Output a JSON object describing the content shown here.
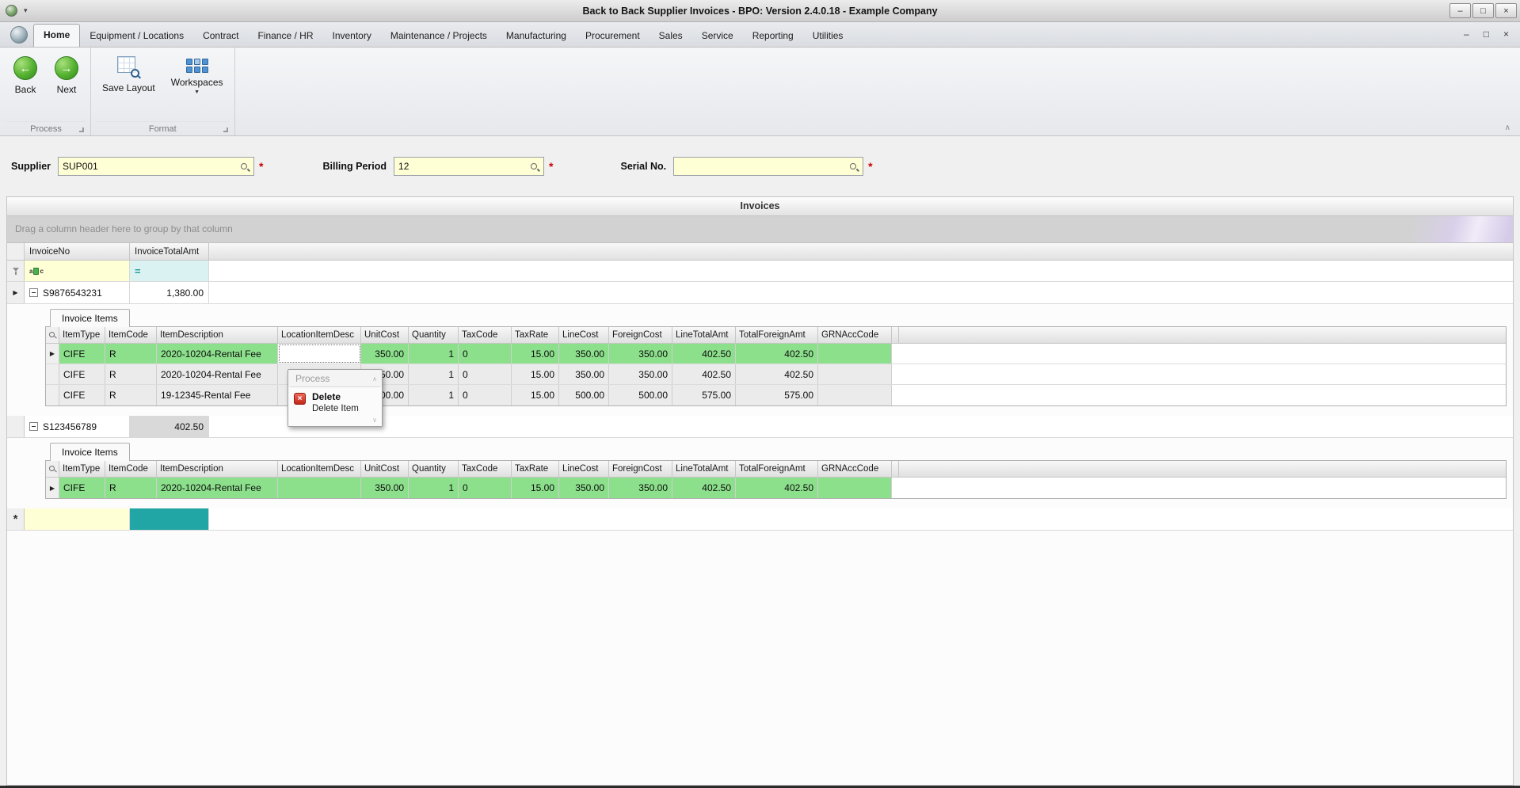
{
  "window": {
    "title": "Back to Back Supplier Invoices - BPO: Version 2.4.0.18 - Example Company"
  },
  "icons": {
    "minimize": "–",
    "maximize": "□",
    "close": "×",
    "qat_dropdown": "▾",
    "back_arrow": "←",
    "next_arrow": "→",
    "workspaces_caret": "▼",
    "ribbon_collapse": "∧",
    "menu_scroll_up": "∧",
    "menu_scroll_down": "∨",
    "row_arrow": "▶",
    "new_row_glyph": "*",
    "abc_left": "a",
    "abc_right": "c"
  },
  "tabs": {
    "items": [
      {
        "label": "Home"
      },
      {
        "label": "Equipment / Locations"
      },
      {
        "label": "Contract"
      },
      {
        "label": "Finance / HR"
      },
      {
        "label": "Inventory"
      },
      {
        "label": "Maintenance / Projects"
      },
      {
        "label": "Manufacturing"
      },
      {
        "label": "Procurement"
      },
      {
        "label": "Sales"
      },
      {
        "label": "Service"
      },
      {
        "label": "Reporting"
      },
      {
        "label": "Utilities"
      }
    ]
  },
  "ribbon": {
    "back_label": "Back",
    "next_label": "Next",
    "save_layout_label": "Save Layout",
    "workspaces_label": "Workspaces",
    "process_group": "Process",
    "format_group": "Format"
  },
  "form": {
    "supplier_label": "Supplier",
    "supplier_value": "SUP001",
    "billing_label": "Billing Period",
    "billing_value": "12",
    "serial_label": "Serial No.",
    "serial_value": "",
    "required_marker": "*"
  },
  "invoices": {
    "panel_title": "Invoices",
    "group_hint": "Drag a column header here to group by that column",
    "col_invoice_no": "InvoiceNo",
    "col_total": "InvoiceTotalAmt",
    "filter_equals": "=",
    "detail_tab_label": "Invoice Items",
    "detail_columns": [
      "ItemType",
      "ItemCode",
      "ItemDescription",
      "LocationItemDesc",
      "UnitCost",
      "Quantity",
      "TaxCode",
      "TaxRate",
      "LineCost",
      "ForeignCost",
      "LineTotalAmt",
      "TotalForeignAmt",
      "GRNAccCode"
    ],
    "master_rows": [
      {
        "invoice_no": "S9876543231",
        "total": "1,380.00"
      },
      {
        "invoice_no": "S123456789",
        "total": "402.50"
      }
    ],
    "detail_rows_1": [
      {
        "item_type": "CIFE",
        "item_code": "R",
        "description": "2020-10204-Rental Fee",
        "location": "",
        "unit_cost": "350.00",
        "quantity": "1",
        "tax_code": "0",
        "tax_rate": "15.00",
        "line_cost": "350.00",
        "foreign_cost": "350.00",
        "line_total": "402.50",
        "total_foreign": "402.50",
        "grn_acc": ""
      },
      {
        "item_type": "CIFE",
        "item_code": "R",
        "description": "2020-10204-Rental Fee",
        "location": "",
        "unit_cost": "350.00",
        "quantity": "1",
        "tax_code": "0",
        "tax_rate": "15.00",
        "line_cost": "350.00",
        "foreign_cost": "350.00",
        "line_total": "402.50",
        "total_foreign": "402.50",
        "grn_acc": ""
      },
      {
        "item_type": "CIFE",
        "item_code": "R",
        "description": "19-12345-Rental Fee",
        "location": "",
        "unit_cost": "500.00",
        "quantity": "1",
        "tax_code": "0",
        "tax_rate": "15.00",
        "line_cost": "500.00",
        "foreign_cost": "500.00",
        "line_total": "575.00",
        "total_foreign": "575.00",
        "grn_acc": ""
      }
    ],
    "detail_rows_2": [
      {
        "item_type": "CIFE",
        "item_code": "R",
        "description": "2020-10204-Rental Fee",
        "location": "",
        "unit_cost": "350.00",
        "quantity": "1",
        "tax_code": "0",
        "tax_rate": "15.00",
        "line_cost": "350.00",
        "foreign_cost": "350.00",
        "line_total": "402.50",
        "total_foreign": "402.50",
        "grn_acc": ""
      }
    ]
  },
  "context_menu": {
    "header": "Process",
    "delete_label": "Delete",
    "delete_sublabel": "Delete Item"
  },
  "colors": {
    "highlight_green": "#8ce08c",
    "selection_teal": "#21a5a5",
    "field_yellow": "#ffffd6",
    "filter_cyan": "#daf2f2",
    "required_red": "#cc0000"
  }
}
